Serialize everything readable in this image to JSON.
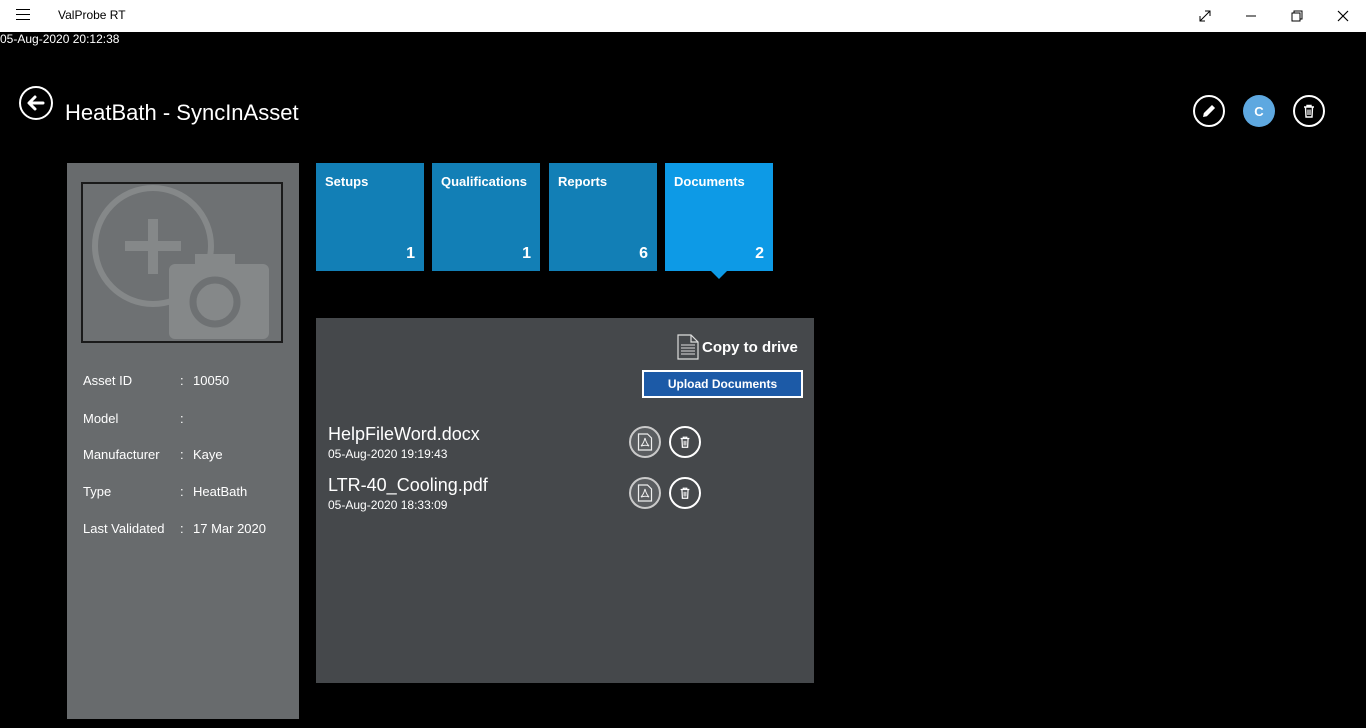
{
  "titlebar": {
    "app_title": "ValProbe RT"
  },
  "datetime": "05-Aug-2020 20:12:38",
  "header": {
    "title": "HeatBath - SyncInAsset",
    "avatar_letter": "C"
  },
  "asset_info": [
    {
      "label": "Asset ID",
      "value": "10050"
    },
    {
      "label": "Model",
      "value": ""
    },
    {
      "label": "Manufacturer",
      "value": "Kaye"
    },
    {
      "label": "Type",
      "value": "HeatBath"
    },
    {
      "label": "Last Validated",
      "value": "17 Mar 2020"
    }
  ],
  "tiles": [
    {
      "label": "Setups",
      "count": "1"
    },
    {
      "label": "Qualifications",
      "count": "1"
    },
    {
      "label": "Reports",
      "count": "6"
    },
    {
      "label": "Documents",
      "count": "2"
    }
  ],
  "documents_panel": {
    "copy_to_drive": "Copy to drive",
    "upload_label": "Upload Documents",
    "files": [
      {
        "name": "HelpFileWord.docx",
        "date": "05-Aug-2020 19:19:43"
      },
      {
        "name": "LTR-40_Cooling.pdf",
        "date": "05-Aug-2020 18:33:09"
      }
    ]
  },
  "colors": {
    "tile": "#127fb6",
    "tile_active": "#0d9ae6",
    "upload_button": "#1c5aa7",
    "avatar": "#5ea8e0"
  }
}
